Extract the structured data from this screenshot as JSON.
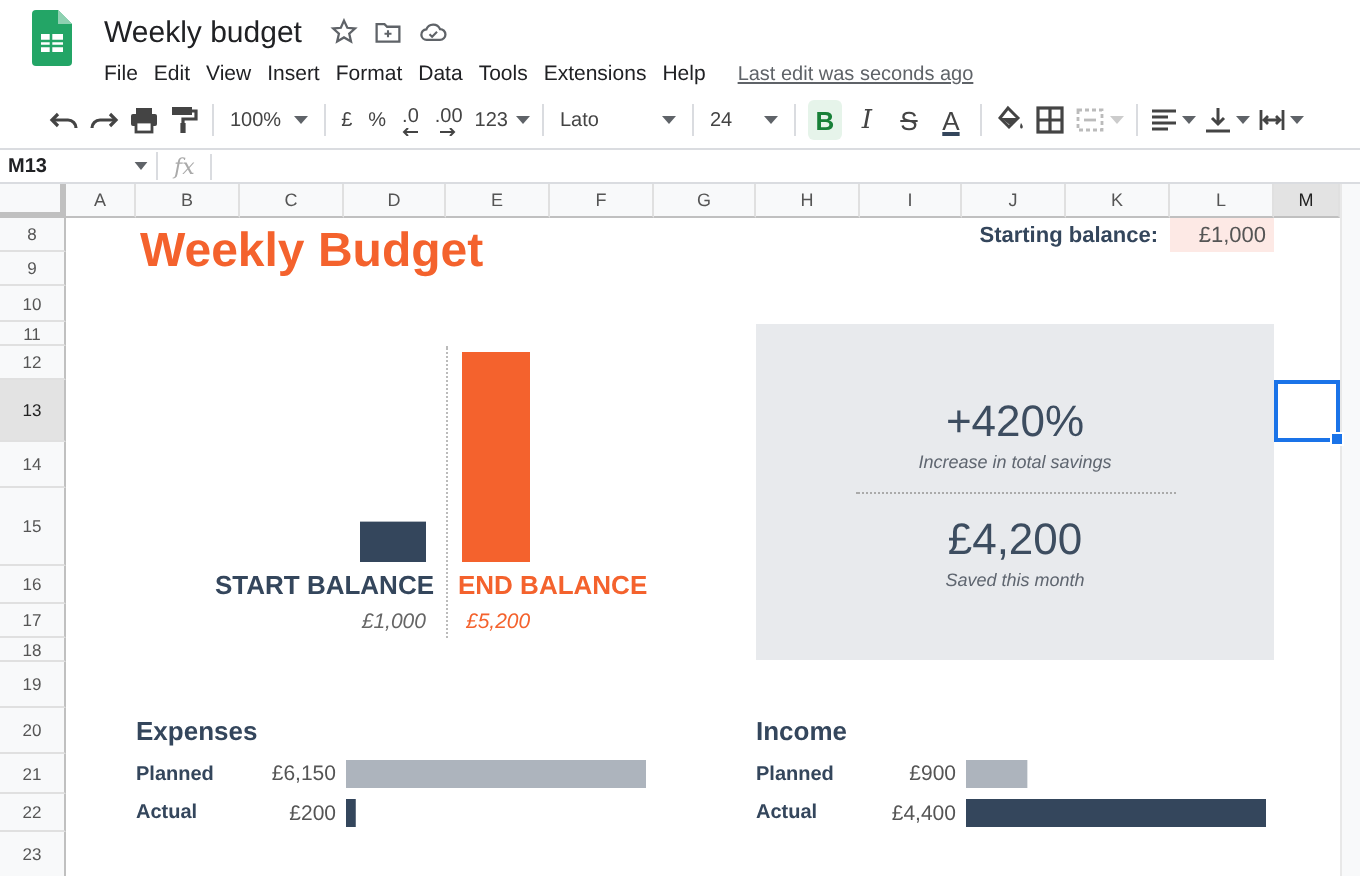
{
  "app": {
    "title": "Weekly budget",
    "menu": [
      "File",
      "Edit",
      "View",
      "Insert",
      "Format",
      "Data",
      "Tools",
      "Extensions",
      "Help"
    ],
    "last_edit": "Last edit was seconds ago"
  },
  "toolbar": {
    "zoom": "100%",
    "currency": "£",
    "percent": "%",
    "decrease_decimals": ".0",
    "increase_decimals": ".00",
    "number_format": "123",
    "font": "Lato",
    "font_size": "24",
    "format_buttons": [
      {
        "kind": "bold",
        "label": "B",
        "active": true
      },
      {
        "kind": "italic",
        "label": "I",
        "active": false
      },
      {
        "kind": "strike",
        "label": "S",
        "active": false
      },
      {
        "kind": "color",
        "label": "A",
        "active": false
      }
    ]
  },
  "formula_bar": {
    "cell": "M13",
    "fx": "fx"
  },
  "columns": [
    {
      "label": "A",
      "selected": false
    },
    {
      "label": "B",
      "selected": false
    },
    {
      "label": "C",
      "selected": false
    },
    {
      "label": "D",
      "selected": false
    },
    {
      "label": "E",
      "selected": false
    },
    {
      "label": "F",
      "selected": false
    },
    {
      "label": "G",
      "selected": false
    },
    {
      "label": "H",
      "selected": false
    },
    {
      "label": "I",
      "selected": false
    },
    {
      "label": "J",
      "selected": false
    },
    {
      "label": "K",
      "selected": false
    },
    {
      "label": "L",
      "selected": false
    },
    {
      "label": "M",
      "selected": true
    }
  ],
  "rows": [
    {
      "label": "8",
      "selected": false
    },
    {
      "label": "9",
      "selected": false
    },
    {
      "label": "10",
      "selected": false
    },
    {
      "label": "11",
      "selected": false
    },
    {
      "label": "12",
      "selected": false
    },
    {
      "label": "13",
      "selected": true
    },
    {
      "label": "14",
      "selected": false
    },
    {
      "label": "15",
      "selected": false
    },
    {
      "label": "16",
      "selected": false
    },
    {
      "label": "17",
      "selected": false
    },
    {
      "label": "18",
      "selected": false
    },
    {
      "label": "19",
      "selected": false
    },
    {
      "label": "20",
      "selected": false
    },
    {
      "label": "21",
      "selected": false
    },
    {
      "label": "22",
      "selected": false
    },
    {
      "label": "23",
      "selected": false
    }
  ],
  "sheet": {
    "title": "Weekly Budget",
    "starting_balance": {
      "label": "Starting balance:",
      "value": "£1,000"
    },
    "chart": {
      "chart_data": {
        "type": "bar",
        "categories": [
          "START BALANCE",
          "END BALANCE"
        ],
        "values": [
          1000,
          5200
        ],
        "value_labels": [
          "£1,000",
          "£5,200"
        ]
      }
    },
    "summary": [
      {
        "value": "+420%",
        "caption": "Increase in total savings"
      },
      {
        "value": "£4,200",
        "caption": "Saved this month"
      }
    ],
    "expenses": {
      "title": "Expenses",
      "chart_data": {
        "type": "bar",
        "orientation": "horizontal",
        "categories": [
          "Planned",
          "Actual"
        ],
        "values": [
          6150,
          200
        ],
        "value_labels": [
          "£6,150",
          "£200"
        ]
      }
    },
    "income": {
      "title": "Income",
      "chart_data": {
        "type": "bar",
        "orientation": "horizontal",
        "categories": [
          "Planned",
          "Actual"
        ],
        "values": [
          900,
          4400
        ],
        "value_labels": [
          "£900",
          "£4,400"
        ]
      }
    }
  }
}
